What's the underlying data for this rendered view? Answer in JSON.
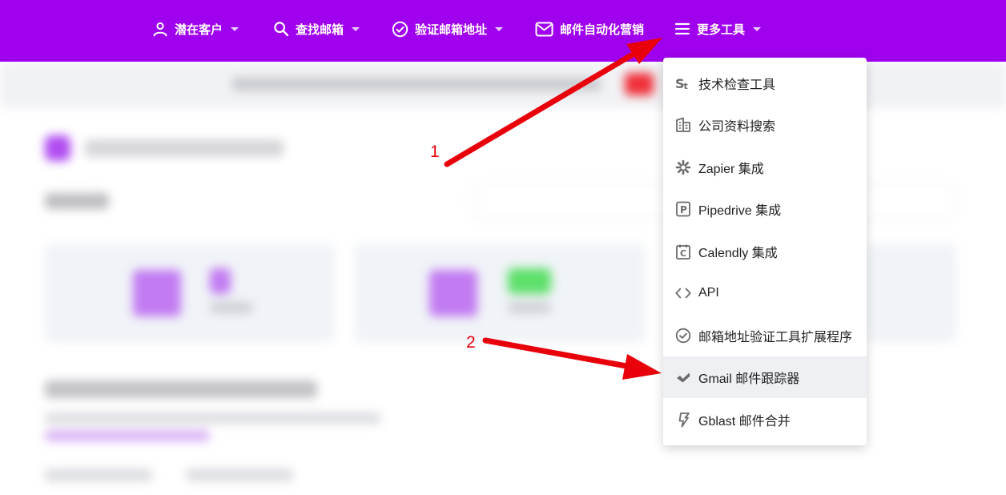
{
  "nav": {
    "items": [
      {
        "label": "潜在客户",
        "icon": "person-icon",
        "caret": true
      },
      {
        "label": "查找邮箱",
        "icon": "search-icon",
        "caret": true
      },
      {
        "label": "验证邮箱地址",
        "icon": "check-circle-icon",
        "caret": true
      },
      {
        "label": "邮件自动化营销",
        "icon": "mail-icon",
        "caret": false
      },
      {
        "label": "更多工具",
        "icon": "menu-icon",
        "caret": true
      }
    ]
  },
  "dropdown": {
    "items": [
      {
        "label": "技术检查工具",
        "icon": "techlookup-icon"
      },
      {
        "label": "公司资料搜索",
        "icon": "building-icon"
      },
      {
        "label": "Zapier 集成",
        "icon": "zapier-icon"
      },
      {
        "label": "Pipedrive 集成",
        "icon": "pipedrive-icon"
      },
      {
        "label": "Calendly 集成",
        "icon": "calendly-icon"
      },
      {
        "label": "API",
        "icon": "code-icon"
      },
      {
        "label": "邮箱地址验证工具扩展程序",
        "icon": "check-circle-icon"
      },
      {
        "label": "Gmail 邮件跟踪器",
        "icon": "mail-tracker-icon"
      },
      {
        "label": "Gblast 邮件合并",
        "icon": "gblast-icon"
      }
    ],
    "active_index": 7
  },
  "annotations": {
    "first": "1",
    "second": "2"
  },
  "colors": {
    "brand": "#9f00ee",
    "annotation": "#e8000b",
    "active_row": "#eef0f4"
  }
}
